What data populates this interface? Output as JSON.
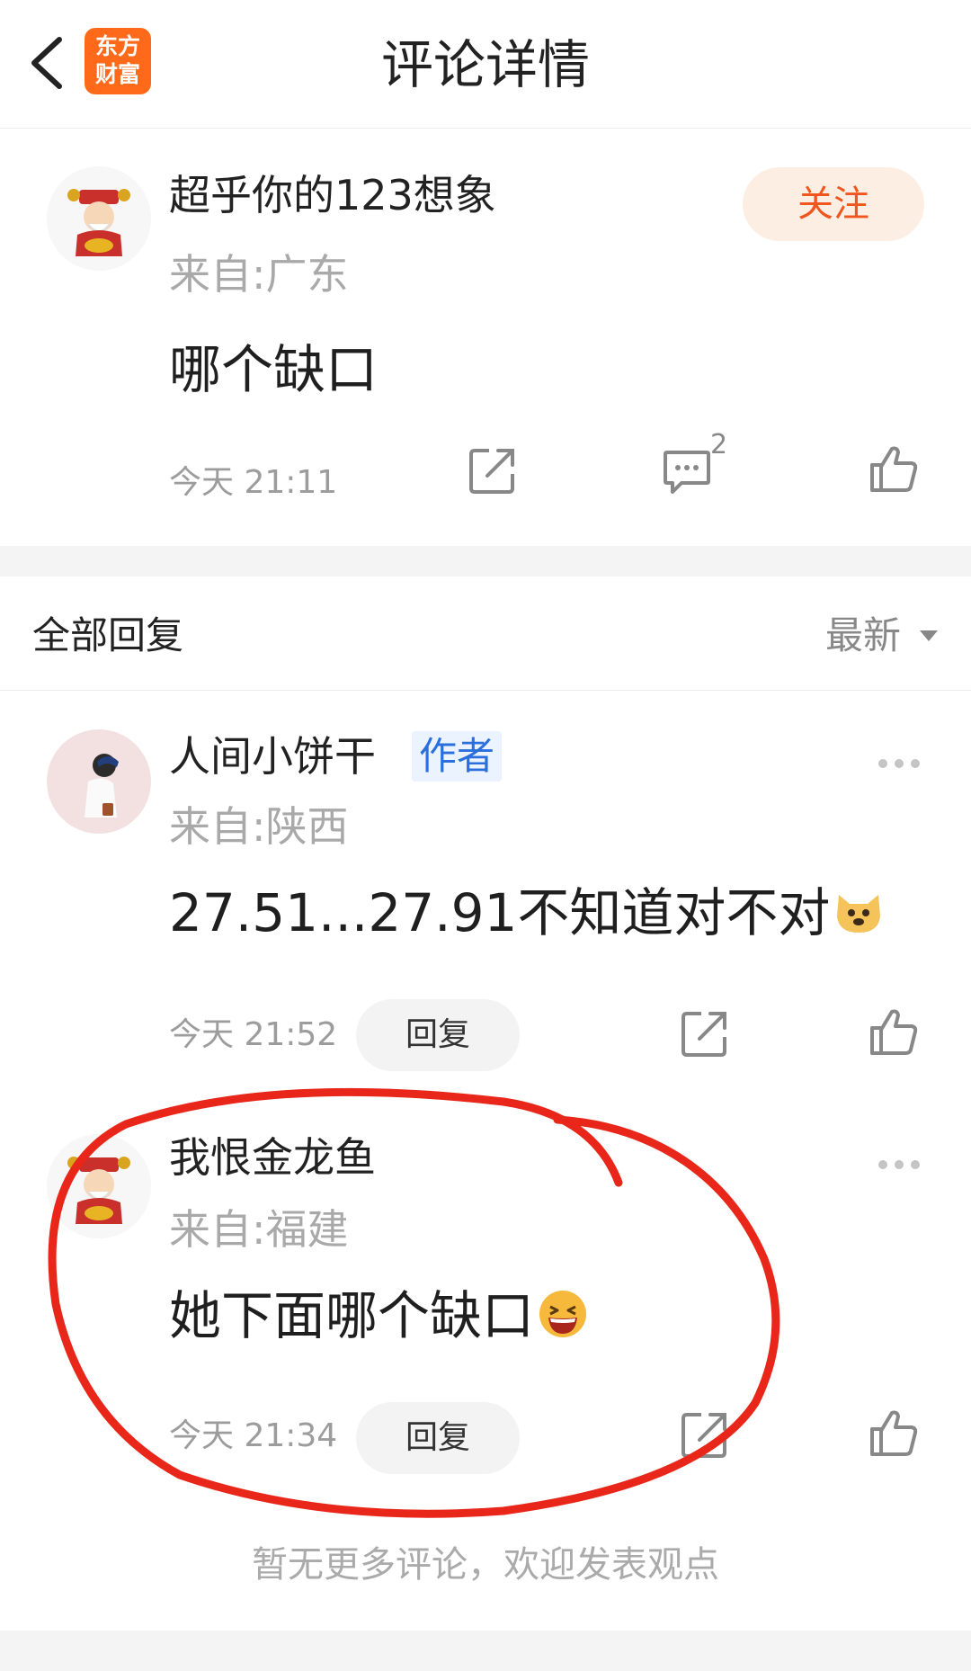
{
  "header": {
    "title": "评论详情",
    "logo_line1": "东方",
    "logo_line2": "财富"
  },
  "main_comment": {
    "username": "超乎你的123想象",
    "location": "来自:广东",
    "content": "哪个缺口",
    "time": "今天 21:11",
    "follow_label": "关注",
    "comment_count": "2"
  },
  "replies_header": {
    "title": "全部回复",
    "sort_label": "最新"
  },
  "replies": [
    {
      "username": "人间小饼干",
      "tag": "作者",
      "location": "来自:陕西",
      "content": "27.51...27.91不知道对不对",
      "time": "今天 21:52",
      "reply_label": "回复",
      "emoji": "doge-emoji"
    },
    {
      "username": "我恨金龙鱼",
      "location": "来自:福建",
      "content": "她下面哪个缺口",
      "time": "今天 21:34",
      "reply_label": "回复",
      "emoji": "laughing-emoji"
    }
  ],
  "footer_text": "暂无更多评论，欢迎发表观点",
  "colors": {
    "accent": "#f0561d",
    "circle_annotation": "#e8271a",
    "author_tag": "#2a6fdb"
  }
}
